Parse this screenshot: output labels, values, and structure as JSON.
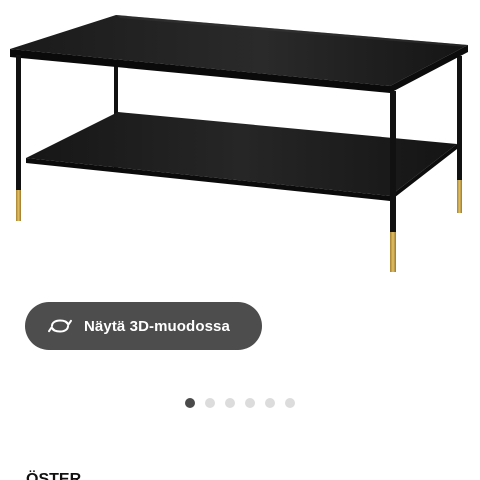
{
  "product": {
    "image_alt": "Black coffee table with gold feet"
  },
  "view_3d": {
    "label": "Näytä 3D-muodossa",
    "icon": "rotate-3d-icon"
  },
  "carousel": {
    "total_dots": 6,
    "active_index": 0
  },
  "below_fold": {
    "heading_fragment": "ÖSTER..."
  },
  "colors": {
    "button_bg": "#4d4d4d",
    "dot_active": "#4a4a4a",
    "dot_inactive": "#dcdcdc",
    "table_black": "#141414",
    "foot_gold": "#c9a24a"
  }
}
